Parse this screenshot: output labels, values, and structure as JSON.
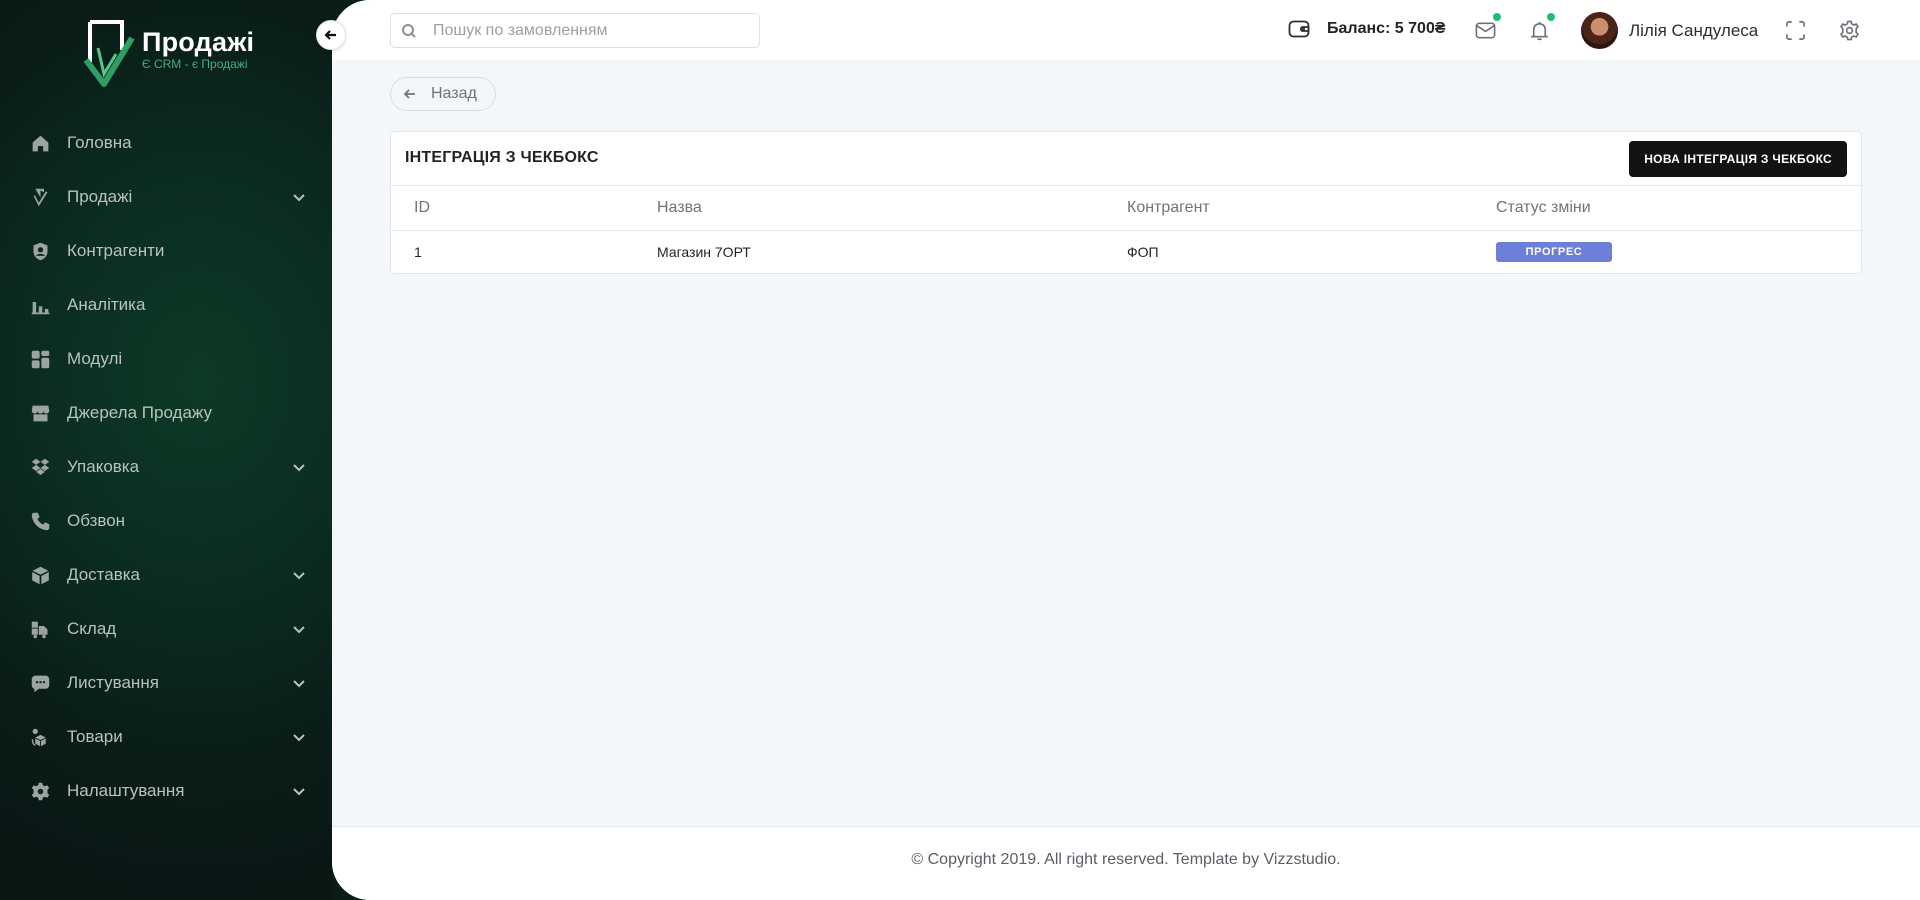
{
  "brand": {
    "name": "Продажі",
    "tagline": "Є CRM - є Продажі"
  },
  "sidebar": {
    "items": [
      {
        "label": "Головна",
        "icon": "home-icon",
        "has_submenu": false
      },
      {
        "label": "Продажі",
        "icon": "sales-icon",
        "has_submenu": true
      },
      {
        "label": "Контрагенти",
        "icon": "user-shield-icon",
        "has_submenu": false
      },
      {
        "label": "Аналітика",
        "icon": "bar-chart-icon",
        "has_submenu": false
      },
      {
        "label": "Модулі",
        "icon": "grid-icon",
        "has_submenu": false
      },
      {
        "label": "Джерела Продажу",
        "icon": "store-icon",
        "has_submenu": false
      },
      {
        "label": "Упаковка",
        "icon": "dropbox-icon",
        "has_submenu": true
      },
      {
        "label": "Обзвон",
        "icon": "phone-icon",
        "has_submenu": false
      },
      {
        "label": "Доставка",
        "icon": "cube-icon",
        "has_submenu": true
      },
      {
        "label": "Склад",
        "icon": "truck-icon",
        "has_submenu": true
      },
      {
        "label": "Листування",
        "icon": "chat-icon",
        "has_submenu": true
      },
      {
        "label": "Товари",
        "icon": "products-icon",
        "has_submenu": true
      },
      {
        "label": "Налаштування",
        "icon": "gear-icon",
        "has_submenu": true
      }
    ]
  },
  "header": {
    "search_placeholder": "Пошук по замовленням",
    "balance": "Баланс: 5 700₴",
    "user_name": "Лілія Сандулеса"
  },
  "page": {
    "back_label": "Назад",
    "card_title": "ІНТЕГРАЦІЯ З ЧЕКБОКС",
    "new_button": "НОВА ІНТЕГРАЦІЯ З ЧЕКБОКС",
    "table": {
      "columns": [
        "ID",
        "Назва",
        "Контрагент",
        "Статус зміни"
      ],
      "rows": [
        {
          "id": "1",
          "name": "Магазин 7ОРТ",
          "counterparty": "ФОП",
          "status": "ПРОГРЕС"
        }
      ]
    }
  },
  "footer": {
    "text": "© Copyright 2019. All right reserved. Template by Vizzstudio."
  },
  "colors": {
    "sidebar_bg": "#0b2a1f",
    "accent_green": "#3fb07a",
    "status_badge": "#6d7fd8",
    "notification_dot": "#1fbf72",
    "primary_button": "#111315"
  }
}
